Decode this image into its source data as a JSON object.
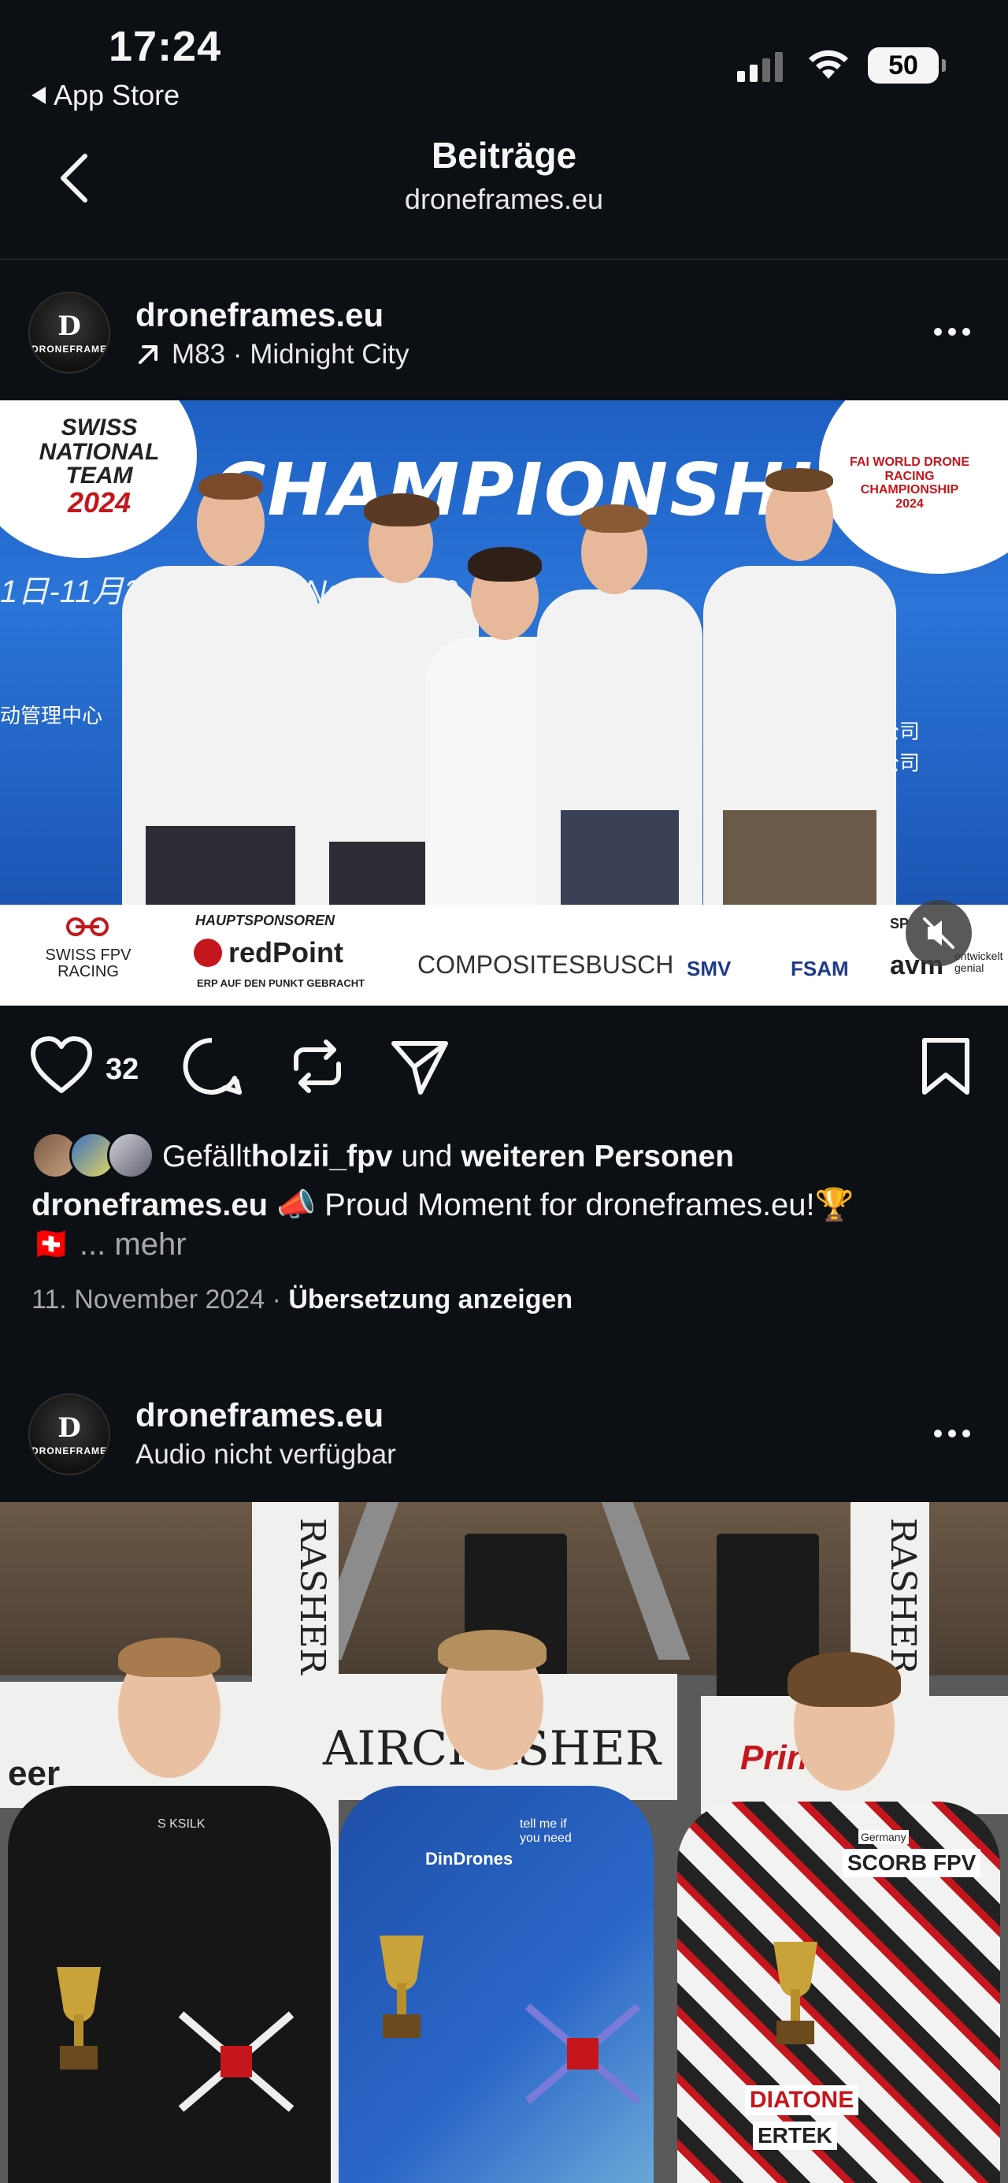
{
  "status_bar": {
    "time": "17:24",
    "back_app": "App Store",
    "battery": "50"
  },
  "nav": {
    "title": "Beiträge",
    "subtitle": "droneframes.eu"
  },
  "post1": {
    "avatar_text": "DRONEFRAME",
    "username": "droneframes.eu",
    "audio": "M83 · Midnight City",
    "image": {
      "headline": "CHAMPIONSHIPS",
      "date_text": "1日-11月3日 ber 31st  Nov 3rd  20",
      "left_badge_line1": "SWISS",
      "left_badge_line2": "NATIONAL TEAM",
      "left_badge_line3": "2024",
      "right_badge": "FAI WORLD DRONE RACING CHAMPIONSHIP",
      "right_badge_year": "2024",
      "chinese_left": "动管理中心",
      "chinese_right_1": "限公司",
      "chinese_right_2": "限公司",
      "sponsors_heading": "HAUPTSPONSOREN",
      "sponsors": {
        "swiss_fpv": "SWISS FPV RACING",
        "redpoint": "redPoint",
        "redpoint_tag": "ERP AUF DEN PUNKT GEBRACHT",
        "composites": "COMPOSITESBUSCH",
        "smv": "SMV",
        "fsam": "FSAM",
        "avm": "avm",
        "avm_tag": "entwickelt genial",
        "sp_partial": "SP"
      }
    },
    "likes_count": "32",
    "liked_by_prefix": "Gefällt ",
    "liked_by_user": "holzii_fpv",
    "liked_by_middle": " und ",
    "liked_by_rest": "weiteren Personen",
    "caption_user": "droneframes.eu",
    "caption_text": " 📣 Proud Moment for droneframes.eu!🏆",
    "caption_flag": "🇨🇭",
    "caption_more": " ... mehr",
    "date": "11. November 2024",
    "separator": " · ",
    "translate": "Übersetzung anzeigen"
  },
  "post2": {
    "avatar_text": "DRONEFRAME",
    "username": "droneframes.eu",
    "audio": "Audio nicht verfügbar",
    "image": {
      "banner_text": "AIRCRASHER",
      "side_text": "RASHER",
      "left_sign": "eer",
      "right_sign": "Printer",
      "hoodie_text": "S KSILK",
      "jersey_brand": "DinDrones",
      "jersey_slogan": "tell me if you need",
      "jersey3_text": "SCORB FPV",
      "jersey3_sponsor": "DIATONE",
      "jersey3_sponsor2": "ERTEK",
      "jersey3_country": "Germany"
    }
  }
}
